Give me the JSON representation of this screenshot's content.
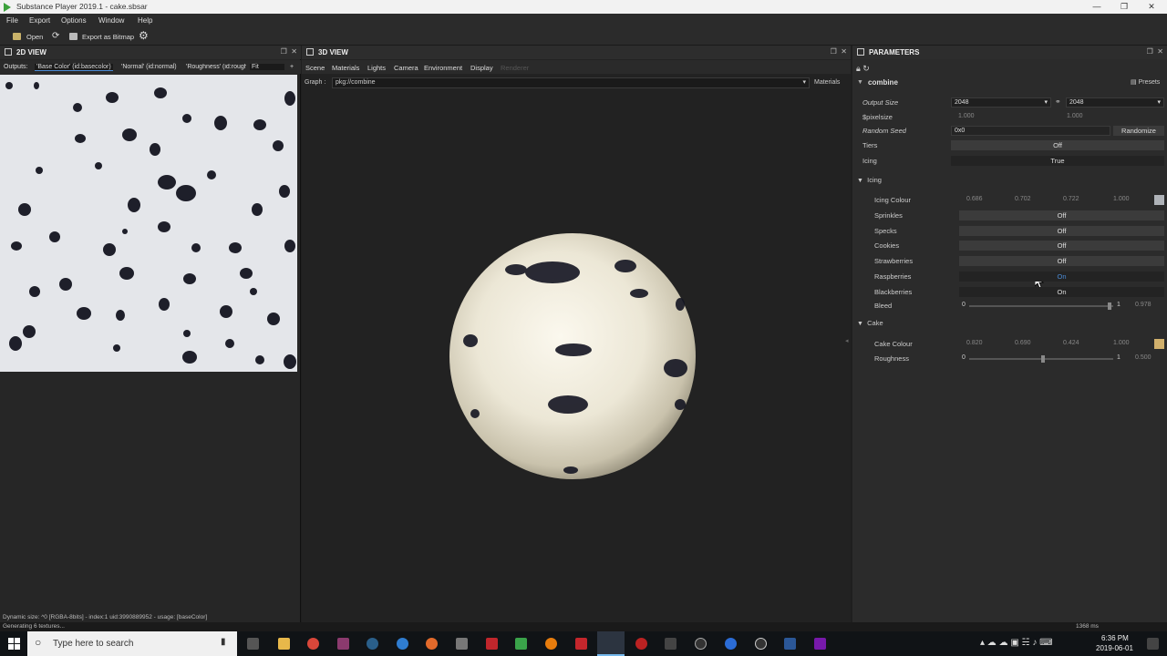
{
  "window": {
    "title": "Substance Player 2019.1 - cake.sbsar"
  },
  "menu": [
    "File",
    "Export",
    "Options",
    "Window",
    "Help"
  ],
  "toolbar": {
    "open": "Open",
    "export": "Export as Bitmap"
  },
  "view2d": {
    "title": "2D VIEW",
    "outputs_label": "Outputs:",
    "outputs": [
      "'Base Color' (id:basecolor)",
      "'Normal' (id:normal)",
      "'Roughness' (id:rough"
    ],
    "fit": "Fit"
  },
  "view3d": {
    "title": "3D VIEW",
    "menu": [
      "Scene",
      "Materials",
      "Lights",
      "Camera",
      "Environment",
      "Display",
      "Renderer"
    ],
    "graph_label": "Graph :",
    "graph_value": "pkg://combine",
    "materials": "Materials"
  },
  "params": {
    "title": "PARAMETERS",
    "graph": "combine",
    "presets": "Presets",
    "output_size": {
      "label": "Output Size",
      "w": "2048",
      "h": "2048"
    },
    "pixel_size": {
      "label": "$pixelsize",
      "a": "1.000",
      "b": "1.000"
    },
    "random_seed": {
      "label": "Random Seed",
      "value": "0x0",
      "button": "Randomize"
    },
    "tiers": {
      "label": "Tiers",
      "value": "Off"
    },
    "icing": {
      "label": "Icing",
      "value": "True"
    },
    "icing_section": "Icing",
    "icing_colour": {
      "label": "Icing Colour",
      "r": "0.686",
      "g": "0.702",
      "b": "0.722",
      "a": "1.000",
      "swatch": "#afb3b8"
    },
    "toggles": [
      {
        "label": "Sprinkles",
        "value": "Off"
      },
      {
        "label": "Specks",
        "value": "Off"
      },
      {
        "label": "Cookies",
        "value": "Off"
      },
      {
        "label": "Strawberries",
        "value": "Off"
      },
      {
        "label": "Raspberries",
        "value": "On"
      },
      {
        "label": "Blackberries",
        "value": "On"
      }
    ],
    "bleed": {
      "label": "Bleed",
      "min": "0",
      "max": "1",
      "value": "0.978"
    },
    "cake_section": "Cake",
    "cake_colour": {
      "label": "Cake Colour",
      "r": "0.820",
      "g": "0.690",
      "b": "0.424",
      "a": "1.000",
      "swatch": "#d1b06c"
    },
    "roughness": {
      "label": "Roughness",
      "min": "0",
      "max": "1",
      "value": "0.500"
    }
  },
  "status": {
    "line1": "Dynamic size: ^0 [RGBA-8bits] - index:1 uid:3990889952 - usage: [baseColor]",
    "line2": "Generating 6 textures...",
    "time": "1368 ms"
  },
  "taskbar": {
    "search": "Type here to search",
    "time": "6:36 PM",
    "date": "2019-06-01"
  }
}
